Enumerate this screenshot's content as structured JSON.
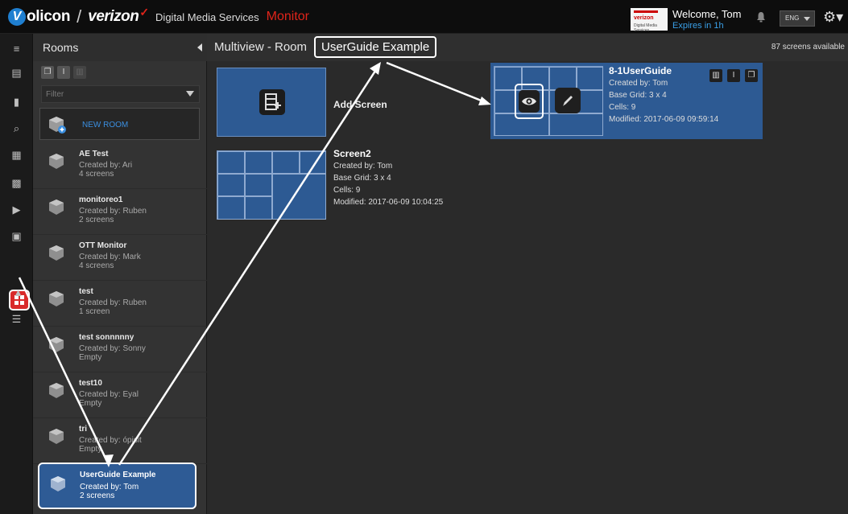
{
  "header": {
    "logo_text": "olicon",
    "logo_partner": "verizon",
    "logo_partner_mark": "✓",
    "division": "Digital Media Services",
    "app_name": "Monitor",
    "brand_box_name": "verizon",
    "brand_box_sub": "Digital Media Services",
    "welcome": "Welcome, Tom",
    "expires": "Expires in 1h",
    "language": "ENG"
  },
  "rooms_panel": {
    "title": "Rooms",
    "filter_placeholder": "Filter",
    "new_room_label": "NEW ROOM",
    "rooms": [
      {
        "name": "AE Test",
        "created_by": "Created by: Ari",
        "count": "4 screens"
      },
      {
        "name": "monitoreo1",
        "created_by": "Created by: Ruben",
        "count": "2 screens"
      },
      {
        "name": "OTT Monitor",
        "created_by": "Created by: Mark",
        "count": "4 screens"
      },
      {
        "name": "test",
        "created_by": "Created by: Ruben",
        "count": "1 screen"
      },
      {
        "name": "test sonnnnny",
        "created_by": "Created by: Sonny",
        "count": "Empty"
      },
      {
        "name": "test10",
        "created_by": "Created by: Eyal",
        "count": "Empty"
      },
      {
        "name": "tri",
        "created_by": "Created by: ópisit",
        "count": "Empty"
      }
    ],
    "selected_room": {
      "name": "UserGuide Example",
      "created_by": "Created by: Tom",
      "count": "2 screens"
    }
  },
  "main": {
    "title_prefix": "Multiview - Room",
    "title_room": "UserGuide Example",
    "screens_available": "87 screens available",
    "add_screen_label": "Add Screen",
    "screens": [
      {
        "title": "8-1UserGuide",
        "created_by": "Created by: Tom",
        "base_grid": "Base Grid: 3 x 4",
        "cells": "Cells: 9",
        "modified": "Modified: 2017-06-09 09:59:14"
      },
      {
        "title": "Screen2",
        "created_by": "Created by: Tom",
        "base_grid": "Base Grid: 3 x 4",
        "cells": "Cells: 9",
        "modified": "Modified: 2017-06-09 10:04:25"
      }
    ]
  },
  "colors": {
    "accent_blue": "#2d5a93",
    "brand_red": "#e0241a",
    "link_blue": "#3b8fe0",
    "active_nav": "#d92a2a"
  }
}
